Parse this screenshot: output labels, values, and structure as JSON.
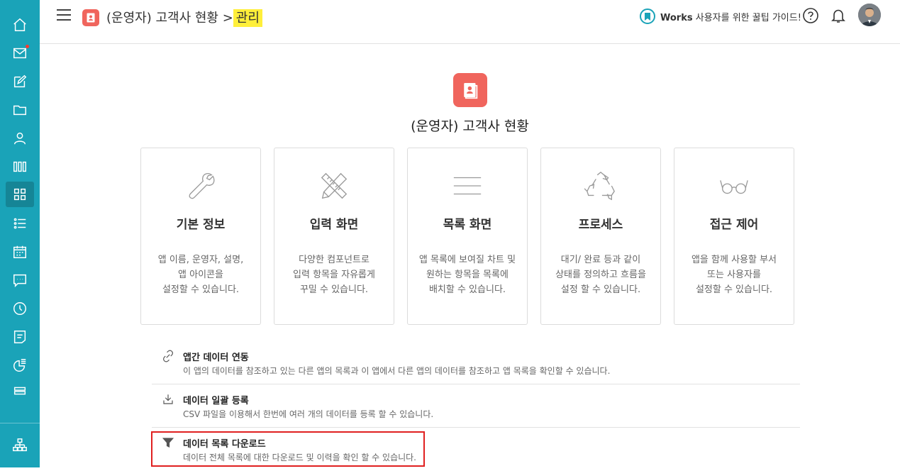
{
  "header": {
    "breadcrumb_app": "(운영자) 고객사 현황 >",
    "breadcrumb_current": "관리",
    "guide_brand": "Works",
    "guide_text": "사용자를 위한 꿀팁 가이드!"
  },
  "sidebar": {
    "items": [
      {
        "icon": "home-icon"
      },
      {
        "icon": "mail-icon",
        "badge": true
      },
      {
        "icon": "edit-icon"
      },
      {
        "icon": "folder-icon"
      },
      {
        "icon": "contacts-icon"
      },
      {
        "icon": "library-icon"
      },
      {
        "icon": "apps-icon",
        "active": true
      },
      {
        "icon": "list-icon"
      },
      {
        "icon": "calendar-icon"
      },
      {
        "icon": "chat-icon"
      },
      {
        "icon": "clock-icon"
      },
      {
        "icon": "notes-icon"
      },
      {
        "icon": "report-icon"
      },
      {
        "icon": "storage-icon"
      }
    ],
    "bottom_icon": "org-chart-icon"
  },
  "app": {
    "title": "(운영자) 고객사 현황"
  },
  "cards": [
    {
      "title": "기본 정보",
      "desc": "앱 이름, 운영자, 설명,\n앱 아이콘을\n설정할 수 있습니다.",
      "icon": "wrench-icon"
    },
    {
      "title": "입력 화면",
      "desc": "다양한 컴포넌트로\n입력 항목을 자유롭게\n꾸밀 수 있습니다.",
      "icon": "ruler-pencil-icon"
    },
    {
      "title": "목록 화면",
      "desc": "앱 목록에 보여질 차트 및\n원하는 항목을 목록에\n배치할 수 있습니다.",
      "icon": "lines-icon"
    },
    {
      "title": "프로세스",
      "desc": "대기/ 완료 등과 같이\n상태를 정의하고 흐름을\n설정 할 수 있습니다.",
      "icon": "recycle-icon"
    },
    {
      "title": "접근 제어",
      "desc": "앱을 함께 사용할 부서\n또는 사용자를\n설정할 수 있습니다.",
      "icon": "glasses-icon"
    }
  ],
  "features": [
    {
      "title": "앱간 데이터 연동",
      "desc": "이 앱의 데이터를 참조하고 있는 다른 앱의 목록과 이 앱에서 다른 앱의 데이터를 참조하고 앱 목록을 확인할 수 있습니다.",
      "icon": "link-icon"
    },
    {
      "title": "데이터 일괄 등록",
      "desc": "CSV 파일을 이용해서 한번에 여러 개의 데이터를 등록 할 수 있습니다.",
      "icon": "download-tray-icon"
    },
    {
      "title": "데이터 목록 다운로드",
      "desc": "데이터 전체 목록에 대한 다운로드 및 이력을 확인 할 수 있습니다.",
      "icon": "filter-icon"
    }
  ],
  "colors": {
    "sidebar": "#1aa3b8",
    "app_badge": "#f0655d",
    "highlight": "#ffef3a",
    "focus_box": "#e02020"
  }
}
